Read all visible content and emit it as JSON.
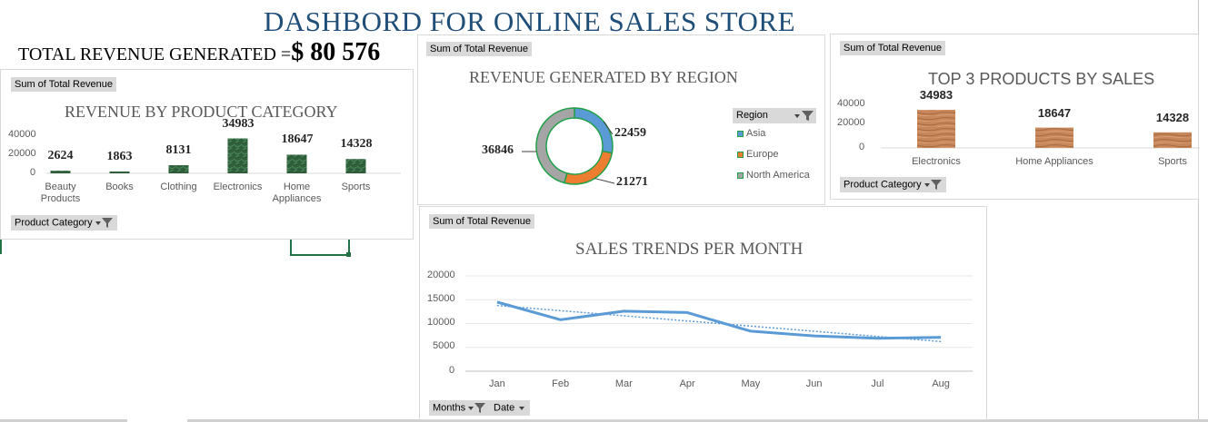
{
  "dashboard": {
    "title": "DASHBORD FOR ONLINE SALES STORE",
    "total_label": "TOTAL REVENUE GENERATED =",
    "total_value": "$ 80 576"
  },
  "charts": {
    "category": {
      "field": "Sum of Total Revenue",
      "filter": "Product Category",
      "title": "REVENUE BY PRODUCT CATEGORY",
      "y_ticks": [
        "40000",
        "20000",
        "0"
      ]
    },
    "region": {
      "field": "Sum of Total Revenue",
      "filter": "Region",
      "title": "REVENUE GENERATED BY REGION"
    },
    "top3": {
      "field": "Sum of Total Revenue",
      "filter": "Product Category",
      "title": "TOP 3  PRODUCTS BY SALES",
      "y_ticks": [
        "40000",
        "20000",
        "0"
      ]
    },
    "trend": {
      "field": "Sum of Total Revenue",
      "filter_months": "Months",
      "filter_date": "Date",
      "title": "SALES TRENDS PER MONTH",
      "y_ticks": [
        "20000",
        "15000",
        "10000",
        "5000",
        "0"
      ]
    }
  },
  "colors": {
    "title": "#1f4e79",
    "asia": "#5b9bd5",
    "europe": "#ed7d31",
    "north_america": "#a5a5a5",
    "donut_outline": "#21a04a",
    "category_bar": "#2e5e3a",
    "top3_bar": "#c8875a",
    "trend_line": "#5b9bd5"
  },
  "chart_data": [
    {
      "type": "bar",
      "title": "REVENUE BY PRODUCT CATEGORY",
      "categories": [
        "Beauty Products",
        "Books",
        "Clothing",
        "Electronics",
        "Home Appliances",
        "Sports"
      ],
      "category_lines": [
        [
          "Beauty",
          "Products"
        ],
        [
          "Books"
        ],
        [
          "Clothing"
        ],
        [
          "Electronics"
        ],
        [
          "Home",
          "Appliances"
        ],
        [
          "Sports"
        ]
      ],
      "values": [
        2624,
        1863,
        8131,
        34983,
        18647,
        14328
      ],
      "ylim": [
        0,
        40000
      ],
      "grid": false,
      "legend": "none"
    },
    {
      "type": "pie",
      "title": "REVENUE GENERATED BY REGION",
      "categories": [
        "Asia",
        "Europe",
        "North America"
      ],
      "values": [
        22459,
        21271,
        36846
      ],
      "legend": "right"
    },
    {
      "type": "bar",
      "title": "TOP 3  PRODUCTS BY SALES",
      "categories": [
        "Electronics",
        "Home Appliances",
        "Sports"
      ],
      "values": [
        34983,
        18647,
        14328
      ],
      "ylim": [
        0,
        40000
      ],
      "grid": false,
      "legend": "none"
    },
    {
      "type": "line",
      "title": "SALES TRENDS PER MONTH",
      "categories": [
        "Jan",
        "Feb",
        "Mar",
        "Apr",
        "May",
        "Jun",
        "Jul",
        "Aug"
      ],
      "values": [
        14500,
        10800,
        12600,
        12300,
        8400,
        7400,
        6900,
        7100
      ],
      "trendline": "linear",
      "ylim": [
        0,
        20000
      ],
      "grid": true,
      "legend": "none"
    }
  ]
}
